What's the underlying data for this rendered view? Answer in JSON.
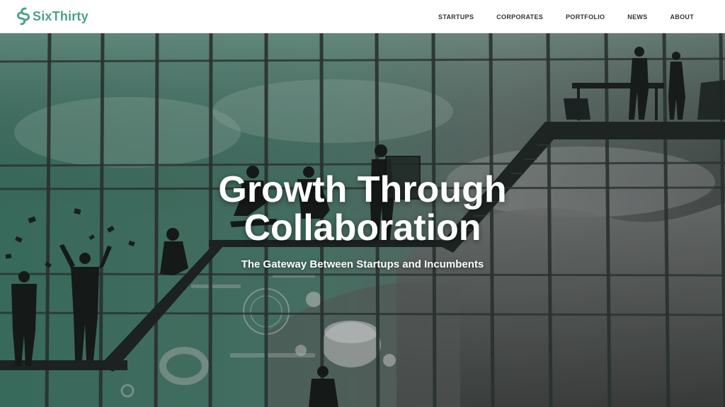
{
  "header": {
    "brand": "SixThirty",
    "nav": [
      "STARTUPS",
      "CORPORATES",
      "PORTFOLIO",
      "NEWS",
      "ABOUT"
    ]
  },
  "hero": {
    "title_line1": "Growth Through",
    "title_line2": "Collaboration",
    "subtitle": "The Gateway Between Startups and Incumbents"
  },
  "colors": {
    "brand": "#4aa386",
    "nav_text": "#333333",
    "hero_text": "#ffffff",
    "tint": "#3f7a6a"
  }
}
